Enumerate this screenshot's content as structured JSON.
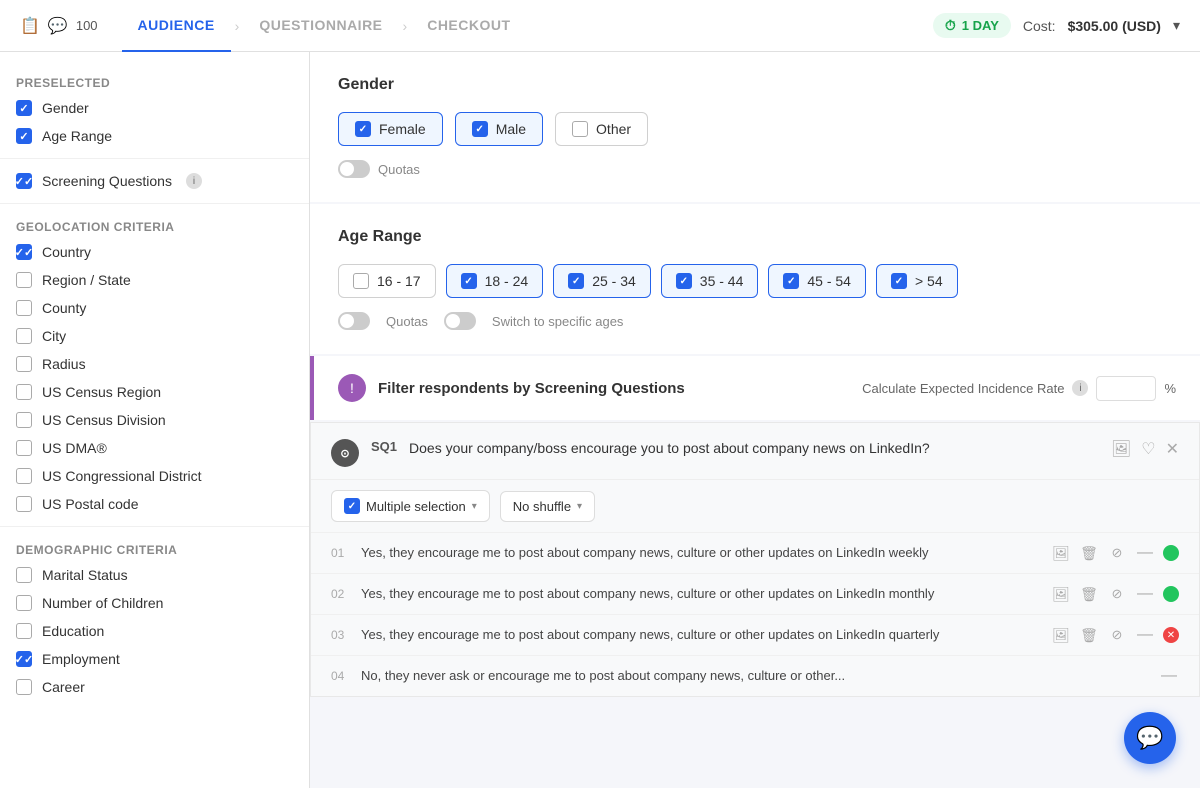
{
  "header": {
    "icon_label": "📋",
    "count": "100",
    "tabs": [
      {
        "id": "audience",
        "label": "AUDIENCE",
        "active": true
      },
      {
        "id": "questionnaire",
        "label": "QUESTIONNAIRE",
        "active": false
      },
      {
        "id": "checkout",
        "label": "CHECKOUT",
        "active": false
      }
    ],
    "time_badge": "1 DAY",
    "cost_label": "Cost:",
    "cost_value": "$305.00 (USD)",
    "dropdown_arrow": "▾"
  },
  "sidebar": {
    "preselected_title": "Preselected",
    "preselected_items": [
      {
        "id": "gender",
        "label": "Gender",
        "checked": true
      },
      {
        "id": "age-range",
        "label": "Age Range",
        "checked": true
      }
    ],
    "screening_label": "Screening Questions",
    "screening_checked": true,
    "geolocation_title": "Geolocation criteria",
    "geolocation_items": [
      {
        "id": "country",
        "label": "Country",
        "checked": true
      },
      {
        "id": "region-state",
        "label": "Region / State",
        "checked": false
      },
      {
        "id": "county",
        "label": "County",
        "checked": false
      },
      {
        "id": "city",
        "label": "City",
        "checked": false
      },
      {
        "id": "radius",
        "label": "Radius",
        "checked": false
      },
      {
        "id": "us-census-region",
        "label": "US Census Region",
        "checked": false
      },
      {
        "id": "us-census-division",
        "label": "US Census Division",
        "checked": false
      },
      {
        "id": "us-dma",
        "label": "US DMA®",
        "checked": false
      },
      {
        "id": "us-congressional-district",
        "label": "US Congressional District",
        "checked": false
      },
      {
        "id": "us-postal-code",
        "label": "US Postal code",
        "checked": false
      }
    ],
    "demographic_title": "Demographic criteria",
    "demographic_items": [
      {
        "id": "marital-status",
        "label": "Marital Status",
        "checked": false
      },
      {
        "id": "number-of-children",
        "label": "Number of Children",
        "checked": false
      },
      {
        "id": "education",
        "label": "Education",
        "checked": false
      },
      {
        "id": "employment",
        "label": "Employment",
        "checked": true
      },
      {
        "id": "career",
        "label": "Career",
        "checked": false
      }
    ]
  },
  "gender_section": {
    "title": "Gender",
    "options": [
      {
        "id": "female",
        "label": "Female",
        "selected": true
      },
      {
        "id": "male",
        "label": "Male",
        "selected": true
      },
      {
        "id": "other",
        "label": "Other",
        "selected": false
      }
    ],
    "quotas_label": "Quotas"
  },
  "age_range_section": {
    "title": "Age Range",
    "options": [
      {
        "id": "16-17",
        "label": "16 - 17",
        "selected": false
      },
      {
        "id": "18-24",
        "label": "18 - 24",
        "selected": true
      },
      {
        "id": "25-34",
        "label": "25 - 34",
        "selected": true
      },
      {
        "id": "35-44",
        "label": "35 - 44",
        "selected": true
      },
      {
        "id": "45-54",
        "label": "45 - 54",
        "selected": true
      },
      {
        "id": "54plus",
        "label": "> 54",
        "selected": true
      }
    ],
    "quotas_label": "Quotas",
    "switch_label": "Switch to specific ages"
  },
  "filter_section": {
    "icon": "!",
    "title": "Filter respondents by Screening Questions",
    "incidence_label": "Calculate Expected Incidence Rate",
    "incidence_placeholder": "",
    "pct_symbol": "%"
  },
  "question": {
    "icon": "⊙",
    "id": "SQ1",
    "text": "Does your company/boss encourage you to post about company news on LinkedIn?",
    "type_label": "Multiple selection",
    "shuffle_label": "No shuffle",
    "answers": [
      {
        "num": "01",
        "text": "Yes, they encourage me to post about company news, culture or other updates on LinkedIn weekly",
        "status": "green"
      },
      {
        "num": "02",
        "text": "Yes, they encourage me to post about company news, culture or other updates on LinkedIn monthly",
        "status": "green"
      },
      {
        "num": "03",
        "text": "Yes, they encourage me to post about company news, culture or other updates on LinkedIn quarterly",
        "status": "red"
      },
      {
        "num": "04",
        "text": "No, they never ask or encourage me to post about company news, culture or other...",
        "status": "dash"
      }
    ]
  },
  "chat_icon": "💬"
}
